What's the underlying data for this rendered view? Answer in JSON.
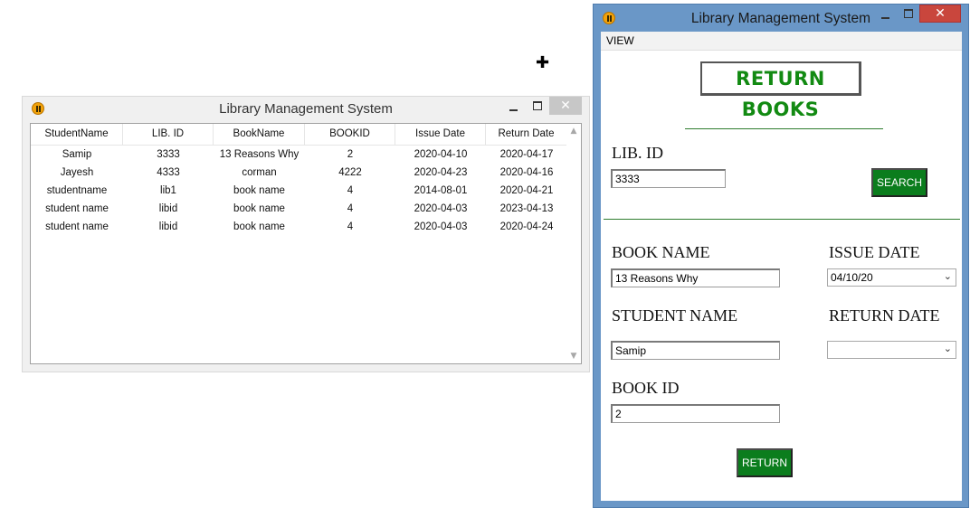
{
  "left_window": {
    "title": "Library Management System",
    "close_glyph": "✕",
    "columns": [
      "StudentName",
      "LIB. ID",
      "BookName",
      "BOOKID",
      "Issue Date",
      "Return Date"
    ],
    "rows": [
      [
        "Samip",
        "3333",
        "13 Reasons Why",
        "2",
        "2020-04-10",
        "2020-04-17"
      ],
      [
        "Jayesh",
        "4333",
        "corman",
        "4222",
        "2020-04-23",
        "2020-04-16"
      ],
      [
        "studentname",
        "lib1",
        "book name",
        "4",
        "2014-08-01",
        "2020-04-21"
      ],
      [
        "student name",
        "libid",
        "book name",
        "4",
        "2020-04-03",
        "2023-04-13"
      ],
      [
        "student name",
        "libid",
        "book name",
        "4",
        "2020-04-03",
        "2020-04-24"
      ]
    ],
    "scroll_up_glyph": "▲",
    "scroll_down_glyph": "▼"
  },
  "right_window": {
    "title": "Library Management System",
    "close_glyph": "✕",
    "menu": {
      "view": "VIEW"
    },
    "banner": "RETURN BOOKS",
    "lib_id": {
      "label": "LIB. ID",
      "value": "3333"
    },
    "search_button": "SEARCH",
    "book_name": {
      "label": "BOOK NAME",
      "value": "13 Reasons Why"
    },
    "issue_date": {
      "label": "ISSUE DATE",
      "value": "04/10/20"
    },
    "student_name": {
      "label": "STUDENT NAME",
      "value": "Samip"
    },
    "return_date": {
      "label": "RETURN DATE",
      "value": ""
    },
    "book_id": {
      "label": "BOOK ID",
      "value": "2"
    },
    "return_button": "RETURN",
    "dropdown_glyph": "⌄"
  },
  "cursor_glyph": "✚",
  "colors": {
    "accent_green": "#0b7d1d",
    "banner_text": "#128a12",
    "title_blue": "#6a97c7",
    "close_red": "#c9463d"
  },
  "icons": [
    "app-icon",
    "minimize-icon",
    "maximize-icon",
    "close-icon",
    "chevron-down-icon"
  ]
}
